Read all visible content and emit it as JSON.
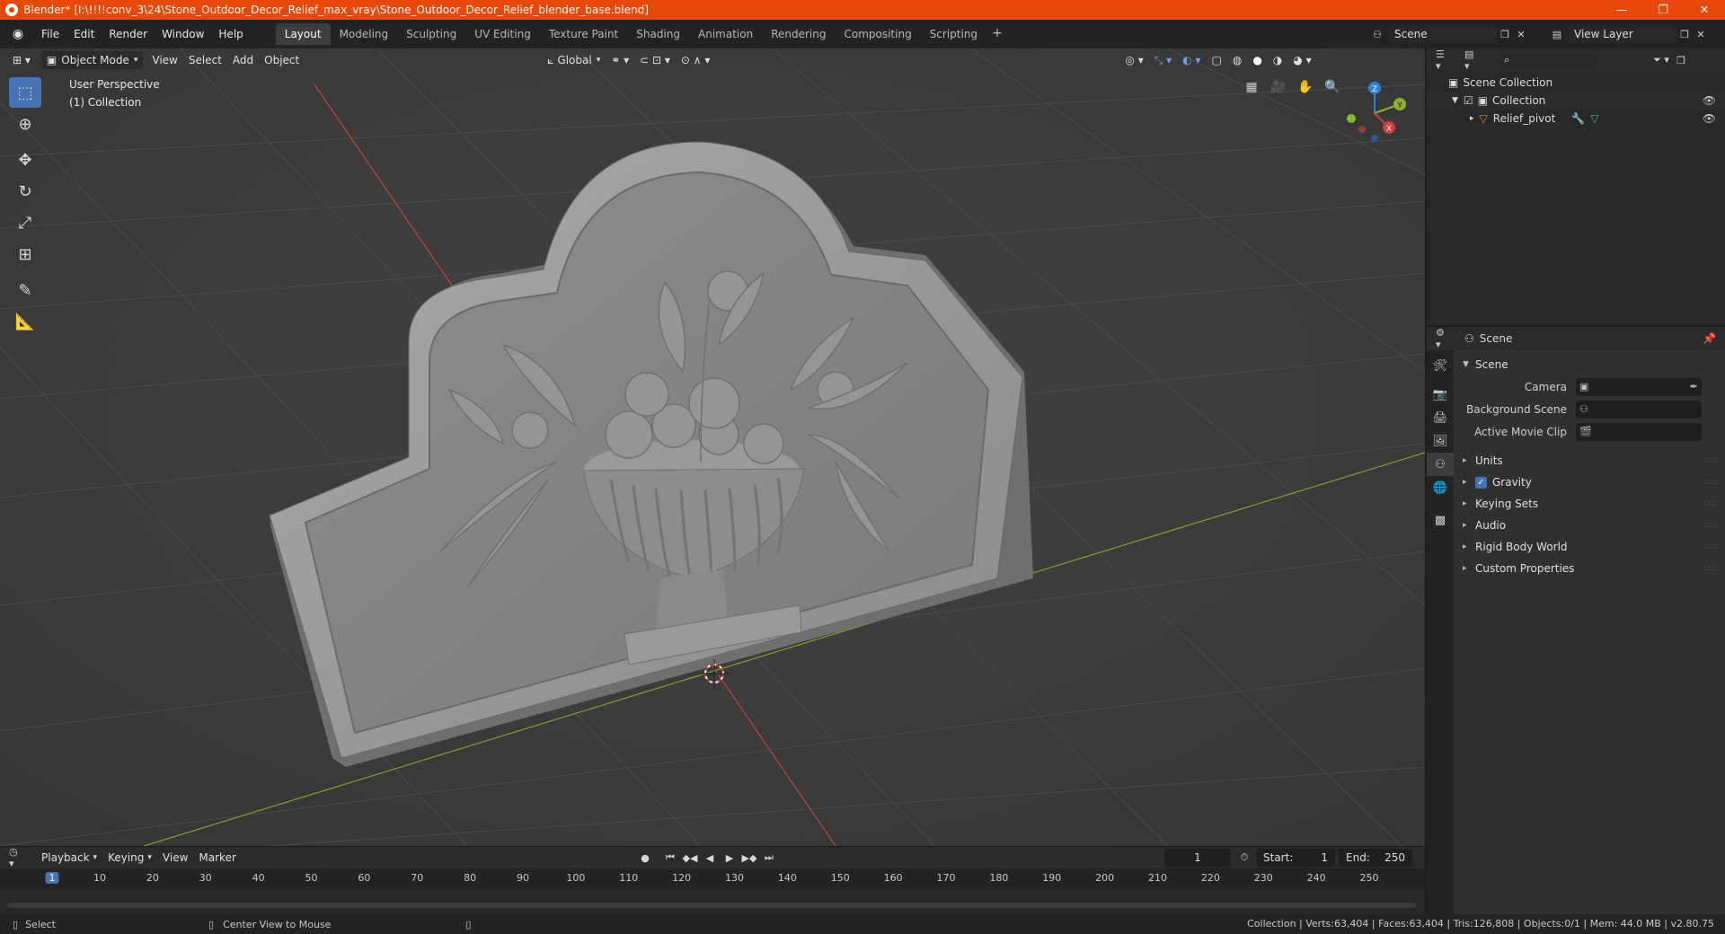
{
  "window": {
    "title": "Blender* [I:\\!!!!conv_3\\24\\Stone_Outdoor_Decor_Relief_max_vray\\Stone_Outdoor_Decor_Relief_blender_base.blend]",
    "minimize": "—",
    "maximize": "❐",
    "close": "✕"
  },
  "menu": {
    "items": [
      "File",
      "Edit",
      "Render",
      "Window",
      "Help"
    ]
  },
  "workspaces": {
    "tabs": [
      "Layout",
      "Modeling",
      "Sculpting",
      "UV Editing",
      "Texture Paint",
      "Shading",
      "Animation",
      "Rendering",
      "Compositing",
      "Scripting"
    ],
    "active": "Layout",
    "add": "+"
  },
  "scene_selector": {
    "value": "Scene"
  },
  "view_layer": {
    "value": "View Layer"
  },
  "viewport": {
    "mode": "Object Mode",
    "menus": [
      "View",
      "Select",
      "Add",
      "Object"
    ],
    "orientation": "Global",
    "overlay_line1": "User Perspective",
    "overlay_line2": "(1) Collection",
    "gizmo": {
      "x": "X",
      "y": "Y",
      "z": "Z"
    }
  },
  "outliner": {
    "search_placeholder": "",
    "rows": [
      {
        "label": "Scene Collection"
      },
      {
        "label": "Collection"
      },
      {
        "label": "Relief_pivot"
      }
    ]
  },
  "properties": {
    "header": "Scene",
    "panel_title": "Scene",
    "fields": [
      {
        "label": "Camera",
        "value": ""
      },
      {
        "label": "Background Scene",
        "value": ""
      },
      {
        "label": "Active Movie Clip",
        "value": ""
      }
    ],
    "subpanels": [
      "Units",
      "Gravity",
      "Keying Sets",
      "Audio",
      "Rigid Body World",
      "Custom Properties"
    ],
    "gravity_checked": true
  },
  "timeline": {
    "menus": [
      "Playback",
      "Keying",
      "View",
      "Marker"
    ],
    "current_frame": "1",
    "start_label": "Start:",
    "start_value": "1",
    "end_label": "End:",
    "end_value": "250",
    "ruler": [
      "1",
      "10",
      "20",
      "30",
      "40",
      "50",
      "60",
      "70",
      "80",
      "90",
      "100",
      "110",
      "120",
      "130",
      "140",
      "150",
      "160",
      "170",
      "180",
      "190",
      "200",
      "210",
      "220",
      "230",
      "240",
      "250"
    ]
  },
  "status": {
    "left_action": "Select",
    "middle_action": "Center View to Mouse",
    "right": "Collection | Verts:63,404 | Faces:63,404 | Tris:126,808 | Objects:0/1 | Mem: 44.0 MB | v2.80.75"
  },
  "colors": {
    "accent": "#4772b3",
    "titlebar": "#e8480a",
    "x_axis": "#d04040",
    "y_axis": "#8cb02a",
    "z_axis": "#2f7fd9"
  }
}
